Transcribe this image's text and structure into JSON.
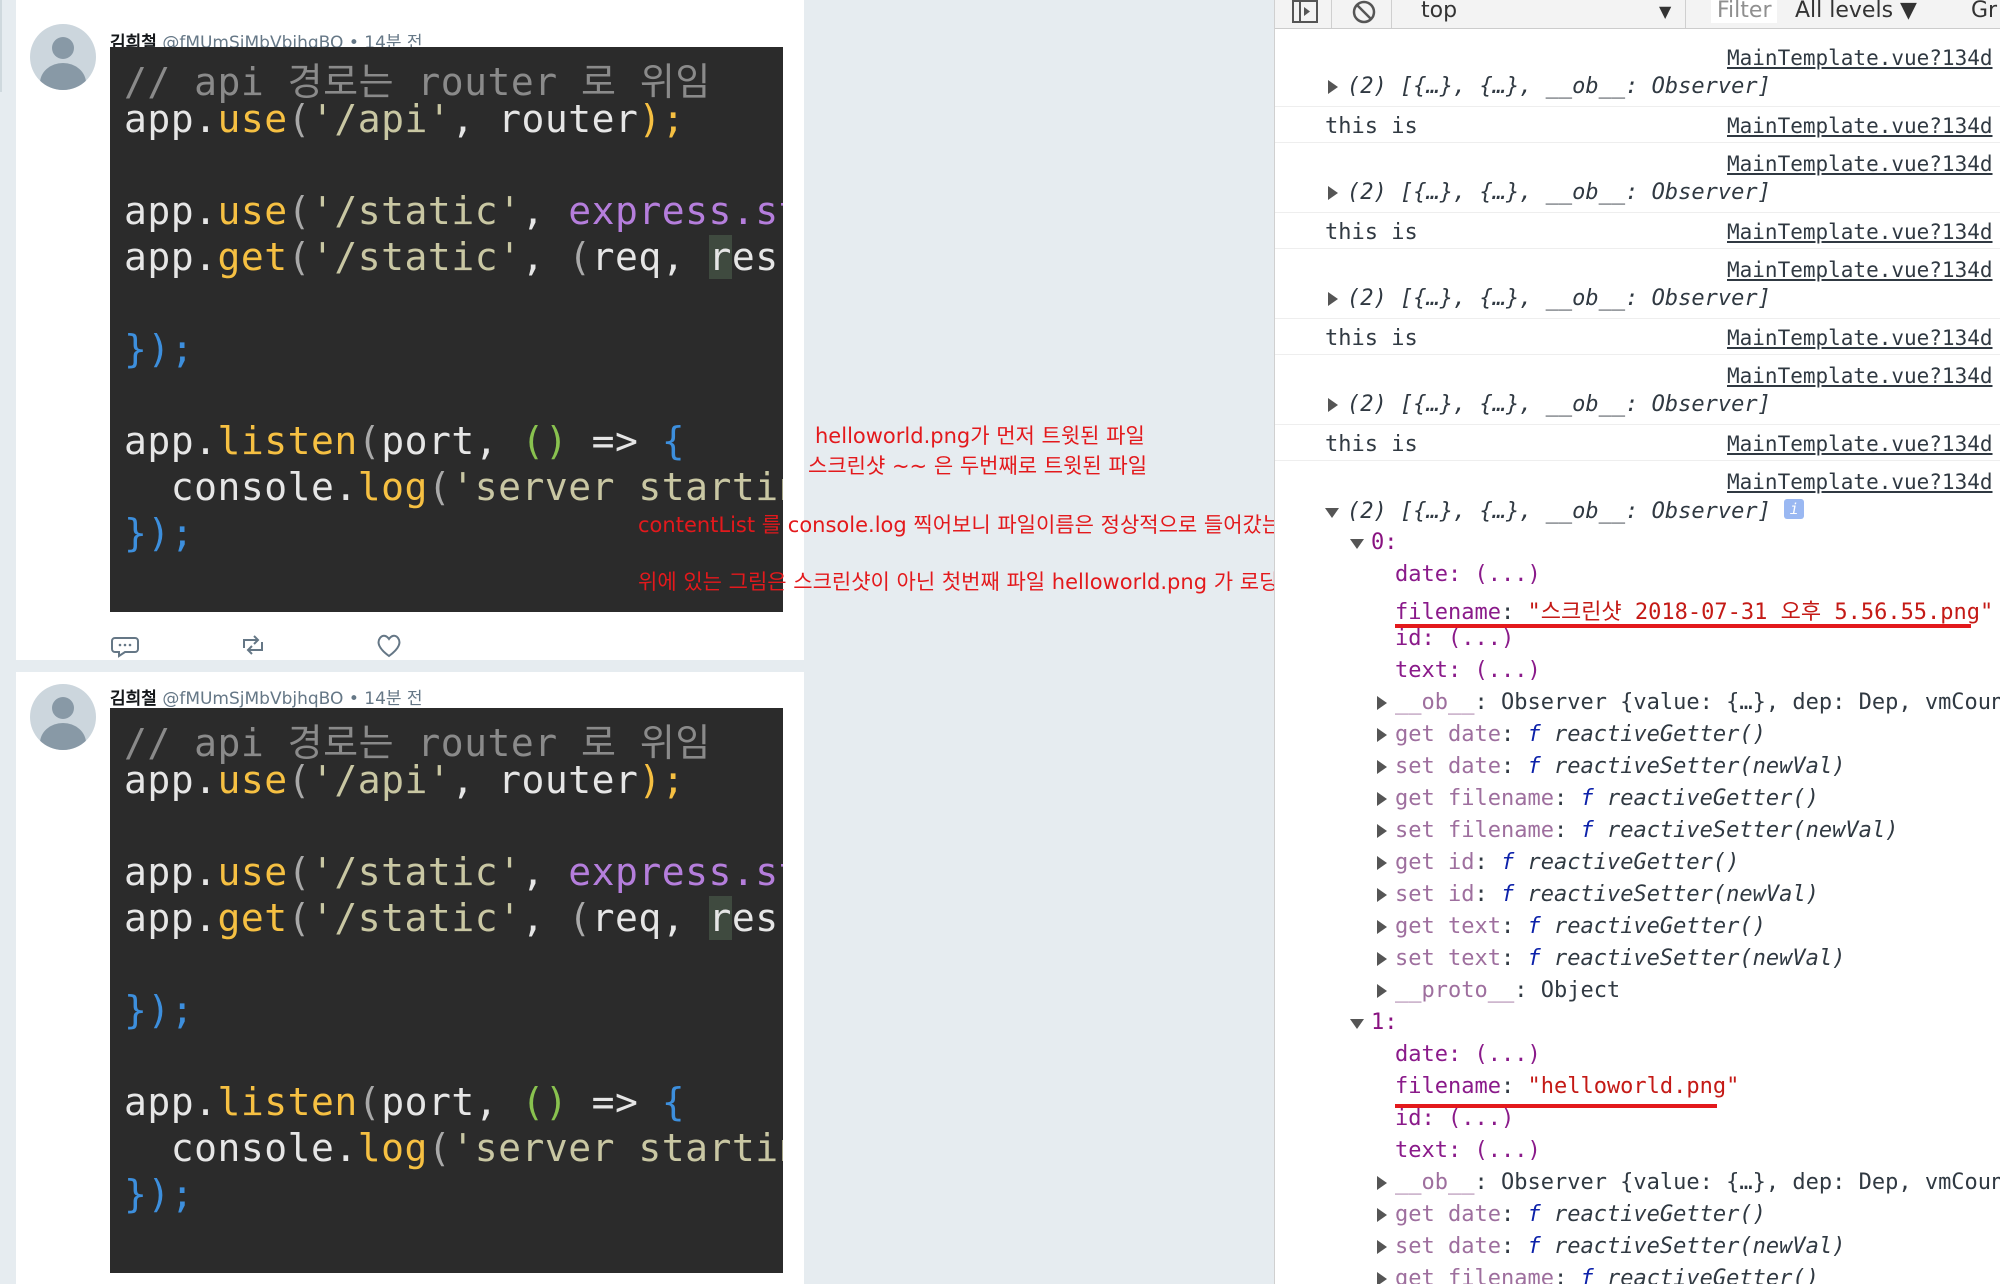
{
  "tweets": [
    {
      "display_name": "김희철",
      "handle": "@fMUmSjMbVbjhqBO",
      "time": "• 14분 전",
      "code": {
        "line1": "// api 경로는 router 로 위임",
        "line2_a": "app.",
        "line2_b": "use",
        "line2_c": "(",
        "line2_d": "'/api'",
        "line2_e": ", ",
        "line2_f": "router",
        "line2_g": ");",
        "line3_a": "app.",
        "line3_b": "use",
        "line3_c": "(",
        "line3_d": "'/static'",
        "line3_e": ", ",
        "line3_f": "express.stat",
        "line4_a": "app.",
        "line4_b": "get",
        "line4_c": "(",
        "line4_d": "'/static'",
        "line4_e": ", ",
        "line4_f": "(",
        "line4_g": "req",
        "line4_h": ", ",
        "line4_i": "r",
        "line4_j": "es",
        "line4_k": ") =",
        "line5": "});",
        "line6_a": "app.",
        "line6_b": "listen",
        "line6_c": "(",
        "line6_d": "port",
        "line6_e": ", ",
        "line6_f": "()",
        "line6_g": " => ",
        "line6_h": "{",
        "line7_a": "  console.",
        "line7_b": "log",
        "line7_c": "(",
        "line7_d": "'server starting",
        "line8": "});"
      }
    },
    {
      "display_name": "김희철",
      "handle": "@fMUmSjMbVbjhqBO",
      "time": "• 14분 전"
    }
  ],
  "annotations": {
    "line1": "helloworld.png가 먼저 트윗된 파일",
    "line2": "스크린샷 ~~ 은 두번째로 트윗된 파일",
    "line3": "contentList 를 console.log 찍어보니 파일이름은 정상적으로 들어갔는데",
    "line4": "위에 있는 그림은 스크린샷이 아닌 첫번째 파일 helloworld.png 가 로딩됨"
  },
  "devtools": {
    "context": "top",
    "filter_placeholder": "Filter",
    "levels": "All levels ▼",
    "group": "Gr",
    "source_link": "MainTemplate.vue?134d",
    "array_summary": "(2) [{…}, {…}, __ob__: Observer]",
    "log_text": "this is",
    "info_badge": "i",
    "index0": "0:",
    "index1": "1:",
    "props": {
      "date": "date: (...)",
      "filename_key": "filename",
      "filename0": "\"스크린샷 2018-07-31 오후 5.56.55.png\"",
      "filename1": "\"helloworld.png\"",
      "id": "id: (...)",
      "text": "text: (...)",
      "ob_key": "__ob__",
      "ob_val": ": Observer {value: {…}, dep: Dep, vmCount",
      "get_date": "get date",
      "set_date": "set date",
      "get_filename": "get filename",
      "set_filename": "set filename",
      "get_id": "get id",
      "set_id": "set id",
      "get_text": "get text",
      "set_text": "set text",
      "getter": "reactiveGetter()",
      "setter": "reactiveSetter(newVal)",
      "f": "f",
      "proto_key": "__proto__",
      "proto_val": ": Object"
    }
  }
}
